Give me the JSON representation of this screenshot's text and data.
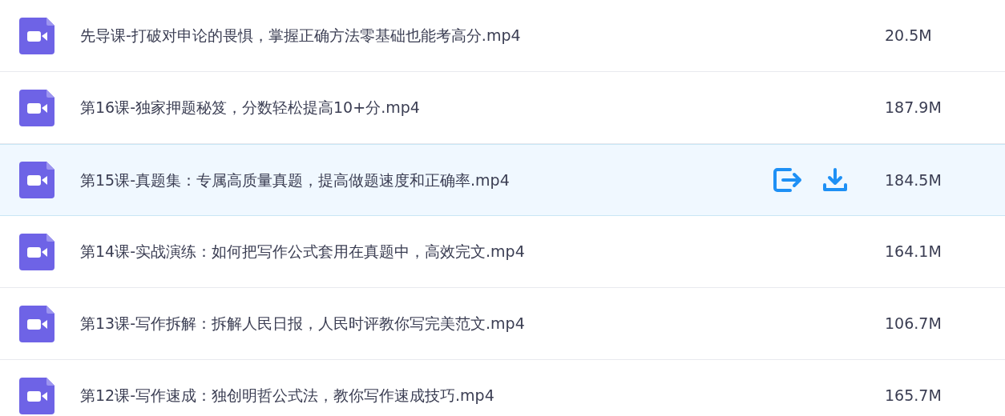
{
  "files": [
    {
      "name": "先导课-打破对申论的畏惧，掌握正确方法零基础也能考高分.mp4",
      "size": "20.5M",
      "selected": false
    },
    {
      "name": "第16课-独家押题秘笈，分数轻松提高10+分.mp4",
      "size": "187.9M",
      "selected": false
    },
    {
      "name": "第15课-真题集：专属高质量真题，提高做题速度和正确率.mp4",
      "size": "184.5M",
      "selected": true
    },
    {
      "name": "第14课-实战演练：如何把写作公式套用在真题中，高效完文.mp4",
      "size": "164.1M",
      "selected": false
    },
    {
      "name": "第13课-写作拆解：拆解人民日报，人民时评教你写完美范文.mp4",
      "size": "106.7M",
      "selected": false
    },
    {
      "name": "第12课-写作速成：独创明哲公式法，教你写作速成技巧.mp4",
      "size": "165.7M",
      "selected": false
    }
  ]
}
